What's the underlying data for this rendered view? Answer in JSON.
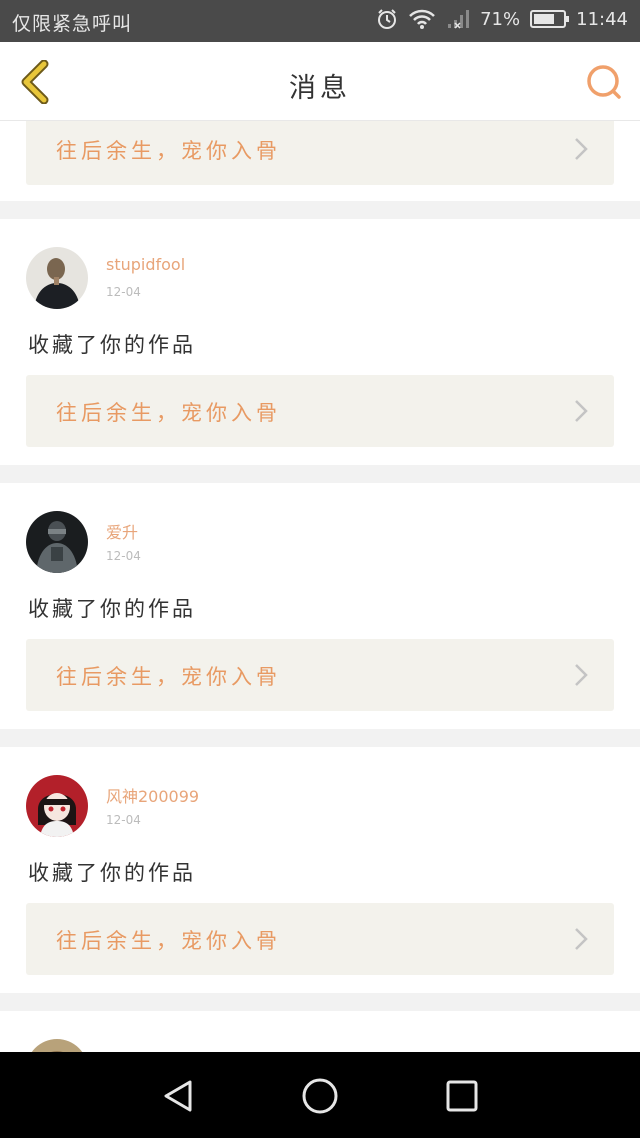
{
  "status_bar": {
    "carrier": "仅限紧急呼叫",
    "battery_text": "71%",
    "battery_level": 0.71,
    "time": "11:44",
    "icons": [
      "alarm-icon",
      "wifi-icon",
      "signal-icon",
      "battery-icon"
    ]
  },
  "header": {
    "title": "消息",
    "back_icon": "chevron-left-icon",
    "search_icon": "search-icon"
  },
  "colors": {
    "accent": "#e89a63",
    "back_arrow": "#e8c63a",
    "box_bg": "#f3f2ec"
  },
  "partial_top": {
    "work_title": "往后余生，宠你入骨"
  },
  "messages": [
    {
      "username": "stupidfool",
      "date": "12-04",
      "action": "收藏了你的作品",
      "work_title": "往后余生，宠你入骨"
    },
    {
      "username": "爱升",
      "date": "12-04",
      "action": "收藏了你的作品",
      "work_title": "往后余生，宠你入骨"
    },
    {
      "username": "风神200099",
      "date": "12-04",
      "action": "收藏了你的作品",
      "work_title": "往后余生，宠你入骨"
    }
  ],
  "nav_bar": {
    "icons": [
      "back-triangle-icon",
      "home-circle-icon",
      "recents-square-icon"
    ]
  }
}
